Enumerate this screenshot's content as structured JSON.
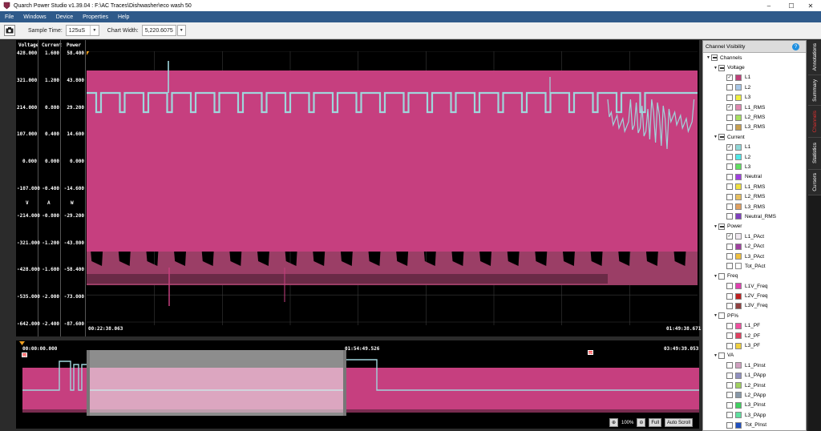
{
  "window": {
    "title": "Quarch Power Studio v1.39.04 : F:\\AC Traces\\Dishwasher\\eco wash 50",
    "controls": [
      "–",
      "☐",
      "✕"
    ]
  },
  "menu": [
    "File",
    "Windows",
    "Device",
    "Properties",
    "Help"
  ],
  "toolbar": {
    "sample_time_label": "Sample Time:",
    "sample_time_value": "125uS",
    "chart_width_label": "Chart Width:",
    "chart_width_value": "5,220.6075"
  },
  "axes": {
    "headers": [
      "Voltage",
      "Current",
      "Power"
    ],
    "units": [
      "V",
      "A",
      "W"
    ],
    "voltage_ticks": [
      "428.000",
      "321.000",
      "214.000",
      "107.000",
      "0.000",
      "-107.000",
      "-214.000",
      "-321.000",
      "-428.000",
      "-535.000",
      "-642.000"
    ],
    "current_ticks": [
      "1.600",
      "1.200",
      "0.800",
      "0.400",
      "0.000",
      "-0.400",
      "-0.800",
      "-1.200",
      "-1.600",
      "-2.000",
      "-2.400"
    ],
    "power_ticks": [
      "58.400",
      "43.800",
      "29.200",
      "14.600",
      "0.000",
      "-14.600",
      "-29.200",
      "-43.800",
      "-58.400",
      "-73.000",
      "-87.600"
    ]
  },
  "main_chart": {
    "start_time": "00:22:38.063",
    "end_time": "01:49:38.671"
  },
  "overview": {
    "start_time": "00:00:00.000",
    "mid_time": "01:54:49.526",
    "end_time": "03:49:39.053",
    "marker_label": "SP",
    "zoom": "100%",
    "full_label": "Full",
    "autoscroll_label": "Auto Scroll"
  },
  "panel": {
    "title": "Channel Visibility",
    "help": "?",
    "root": "Channels",
    "groups": [
      {
        "name": "Voltage",
        "checked": "partial",
        "items": [
          {
            "name": "L1",
            "color": "#c0407a",
            "checked": true
          },
          {
            "name": "L2",
            "color": "#a8c8e8",
            "checked": false
          },
          {
            "name": "L3",
            "color": "#f0f040",
            "checked": false
          },
          {
            "name": "L1_RMS",
            "color": "#e088b0",
            "checked": true
          },
          {
            "name": "L2_RMS",
            "color": "#a8e060",
            "checked": false
          },
          {
            "name": "L3_RMS",
            "color": "#c8a050",
            "checked": false
          }
        ]
      },
      {
        "name": "Current",
        "checked": "partial",
        "items": [
          {
            "name": "L1",
            "color": "#90d8d8",
            "checked": true
          },
          {
            "name": "L2",
            "color": "#50e8e8",
            "checked": false
          },
          {
            "name": "L3",
            "color": "#60e060",
            "checked": false
          },
          {
            "name": "Neutral",
            "color": "#a040e0",
            "checked": false
          },
          {
            "name": "L1_RMS",
            "color": "#f0e040",
            "checked": false
          },
          {
            "name": "L2_RMS",
            "color": "#e8c060",
            "checked": false
          },
          {
            "name": "L3_RMS",
            "color": "#e0a060",
            "checked": false
          },
          {
            "name": "Neutral_RMS",
            "color": "#8040c0",
            "checked": false
          }
        ]
      },
      {
        "name": "Power",
        "checked": "partial",
        "items": [
          {
            "name": "L1_PAct",
            "color": "#f0e8f0",
            "checked": true
          },
          {
            "name": "L2_PAct",
            "color": "#a040a0",
            "checked": false
          },
          {
            "name": "L3_PAct",
            "color": "#f0c040",
            "checked": false
          },
          {
            "name": "Tot_PAct",
            "color": "#ffffff",
            "checked": false
          }
        ]
      },
      {
        "name": "Freq",
        "checked": "none",
        "items": [
          {
            "name": "L1V_Freq",
            "color": "#e040b0",
            "checked": false
          },
          {
            "name": "L2V_Freq",
            "color": "#c02020",
            "checked": false
          },
          {
            "name": "L3V_Freq",
            "color": "#904040",
            "checked": false
          }
        ]
      },
      {
        "name": "PF%",
        "checked": "none",
        "items": [
          {
            "name": "L1_PF",
            "color": "#f050a0",
            "checked": false
          },
          {
            "name": "L2_PF",
            "color": "#e04060",
            "checked": false
          },
          {
            "name": "L3_PF",
            "color": "#f0d040",
            "checked": false
          }
        ]
      },
      {
        "name": "VA",
        "checked": "none",
        "items": [
          {
            "name": "L1_PInst",
            "color": "#d0a0c0",
            "checked": false
          },
          {
            "name": "L1_PApp",
            "color": "#9090c0",
            "checked": false
          },
          {
            "name": "L2_PInst",
            "color": "#a0d060",
            "checked": false
          },
          {
            "name": "L2_PApp",
            "color": "#8898a8",
            "checked": false
          },
          {
            "name": "L3_PInst",
            "color": "#40d060",
            "checked": false
          },
          {
            "name": "L3_PApp",
            "color": "#60e0a0",
            "checked": false
          },
          {
            "name": "Tot_PInst",
            "color": "#2050c0",
            "checked": false
          }
        ]
      }
    ]
  },
  "side_tabs": [
    "Annotations",
    "Summary",
    "Channels",
    "Statistics",
    "Cursors"
  ],
  "colors": {
    "voltage": "#c63f7f",
    "current": "#9fd6dc",
    "power_floor": "#9b3e66"
  }
}
